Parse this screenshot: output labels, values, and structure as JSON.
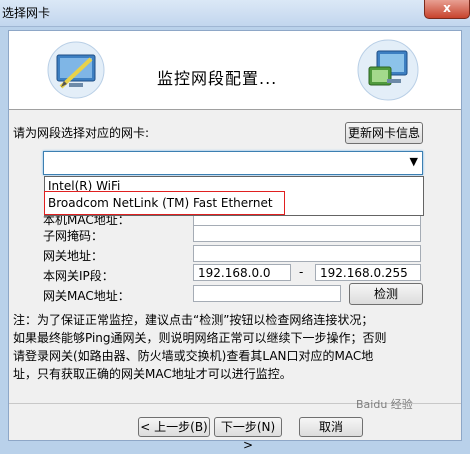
{
  "window": {
    "title": "选择网卡",
    "close_label": "x"
  },
  "header": {
    "title": "监控网段配置..."
  },
  "adapter_select": {
    "prompt": "请为网段选择对应的网卡:",
    "refresh_button": "更新网卡信息",
    "selected_value": "",
    "options": [
      "Intel(R) WiFi",
      "Broadcom NetLink (TM) Fast Ethernet"
    ],
    "highlighted_option": "Broadcom NetLink (TM) Fast Ethernet"
  },
  "form": {
    "partial_label": "本机MAC地址：",
    "subnet_mask_label": "子网掩码：",
    "gateway_label": "网关地址：",
    "ip_range_label": "本网关IP段：",
    "ip_start": "192.168.0.0",
    "ip_separator": "-",
    "ip_end": "192.168.0.255",
    "gateway_mac_label": "网关MAC地址：",
    "detect_button": "检测"
  },
  "note": {
    "line1": "注：为了保证正常监控，建议点击“检测”按钮以检查网络连接状况；",
    "line2": "如果最终能够Ping通网关，则说明网络正常可以继续下一步操作；否则",
    "line3": "请登录网关(如路由器、防火墙或交换机)查看其LAN口对应的MAC地",
    "line4": "址，只有获取正确的网关MAC地址才可以进行监控。"
  },
  "footer": {
    "back_button": "< 上一步(B)",
    "next_button": "下一步(N) >",
    "cancel_button": "取消"
  },
  "watermark": "Baidu 经验"
}
